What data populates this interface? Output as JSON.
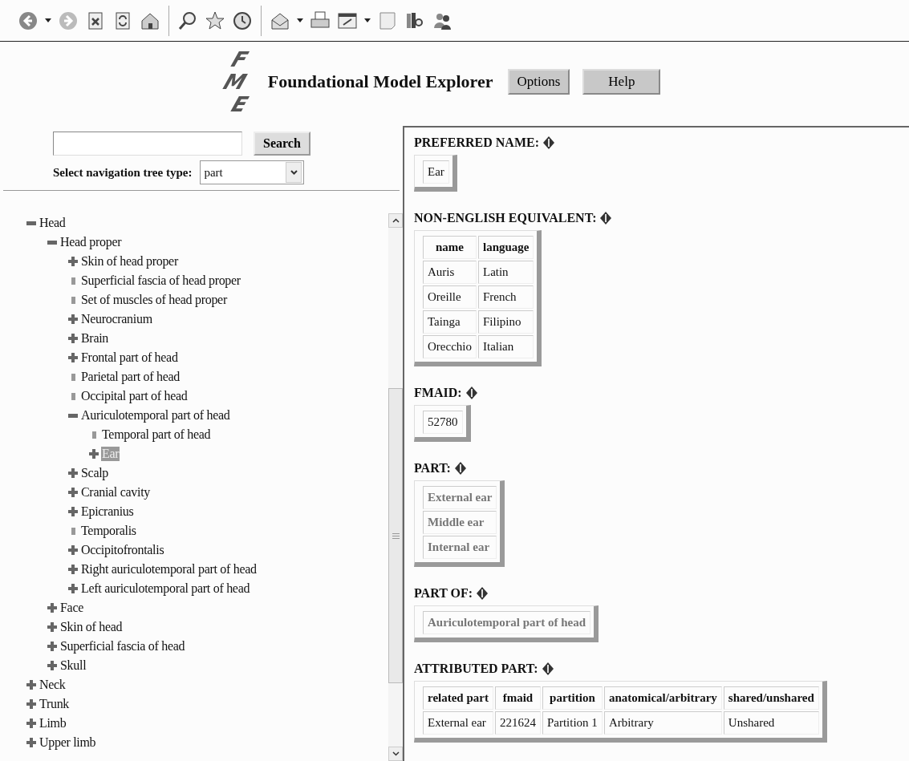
{
  "header": {
    "logo_letters": [
      "F",
      "M",
      "E"
    ],
    "title": "Foundational Model Explorer",
    "buttons": [
      "Options",
      "Help"
    ]
  },
  "search": {
    "button": "Search",
    "tree_type_label": "Select navigation tree type:",
    "tree_type_value": "part"
  },
  "tree": [
    {
      "label": "Head",
      "kind": "expanded",
      "selected": false,
      "children": [
        {
          "label": "Head proper",
          "kind": "expanded",
          "selected": false,
          "children": [
            {
              "label": "Skin of head proper",
              "kind": "collapsed",
              "selected": false
            },
            {
              "label": "Superficial fascia of head proper",
              "kind": "leaf",
              "selected": false
            },
            {
              "label": "Set of muscles of head proper",
              "kind": "leaf",
              "selected": false
            },
            {
              "label": "Neurocranium",
              "kind": "collapsed",
              "selected": false
            },
            {
              "label": "Brain",
              "kind": "collapsed",
              "selected": false
            },
            {
              "label": "Frontal part of head",
              "kind": "collapsed",
              "selected": false
            },
            {
              "label": "Parietal part of head",
              "kind": "leaf",
              "selected": false
            },
            {
              "label": "Occipital part of head",
              "kind": "leaf",
              "selected": false
            },
            {
              "label": "Auriculotemporal part of head",
              "kind": "expanded",
              "selected": false,
              "children": [
                {
                  "label": "Temporal part of head",
                  "kind": "leaf",
                  "selected": false
                },
                {
                  "label": "Ear",
                  "kind": "collapsed",
                  "selected": true
                }
              ]
            },
            {
              "label": "Scalp",
              "kind": "collapsed",
              "selected": false
            },
            {
              "label": "Cranial cavity",
              "kind": "collapsed",
              "selected": false
            },
            {
              "label": "Epicranius",
              "kind": "collapsed",
              "selected": false
            },
            {
              "label": "Temporalis",
              "kind": "leaf",
              "selected": false
            },
            {
              "label": "Occipitofrontalis",
              "kind": "collapsed",
              "selected": false
            },
            {
              "label": "Right auriculotemporal part of head",
              "kind": "collapsed",
              "selected": false
            },
            {
              "label": "Left auriculotemporal part of head",
              "kind": "collapsed",
              "selected": false
            }
          ]
        },
        {
          "label": "Face",
          "kind": "collapsed",
          "selected": false
        },
        {
          "label": "Skin of head",
          "kind": "collapsed",
          "selected": false
        },
        {
          "label": "Superficial fascia of head",
          "kind": "collapsed",
          "selected": false
        },
        {
          "label": "Skull",
          "kind": "collapsed",
          "selected": false
        }
      ]
    },
    {
      "label": "Neck",
      "kind": "collapsed",
      "selected": false
    },
    {
      "label": "Trunk",
      "kind": "collapsed",
      "selected": false
    },
    {
      "label": "Limb",
      "kind": "collapsed",
      "selected": false
    },
    {
      "label": "Upper limb",
      "kind": "collapsed",
      "selected": false
    }
  ],
  "sections": [
    {
      "title": "PREFERRED NAME:",
      "kind": "values",
      "link": false,
      "values": [
        "Ear"
      ]
    },
    {
      "title": "NON-ENGLISH EQUIVALENT:",
      "kind": "table",
      "columns": [
        "name",
        "language"
      ],
      "rows": [
        [
          "Auris",
          "Latin"
        ],
        [
          "Oreille",
          "French"
        ],
        [
          "Tainga",
          "Filipino"
        ],
        [
          "Orecchio",
          "Italian"
        ]
      ]
    },
    {
      "title": "FMAID:",
      "kind": "values",
      "link": false,
      "values": [
        "52780"
      ]
    },
    {
      "title": "PART:",
      "kind": "values",
      "link": true,
      "values": [
        "External ear",
        "Middle ear",
        "Internal ear"
      ]
    },
    {
      "title": "PART OF:",
      "kind": "values",
      "link": true,
      "values": [
        "Auriculotemporal part of head"
      ]
    },
    {
      "title": "ATTRIBUTED PART:",
      "kind": "table",
      "columns": [
        "related part",
        "fmaid",
        "partition",
        "anatomical/arbitrary",
        "shared/unshared"
      ],
      "rows": [
        [
          "External ear",
          "221624",
          "Partition 1",
          "Arbitrary",
          "Unshared"
        ]
      ]
    }
  ]
}
